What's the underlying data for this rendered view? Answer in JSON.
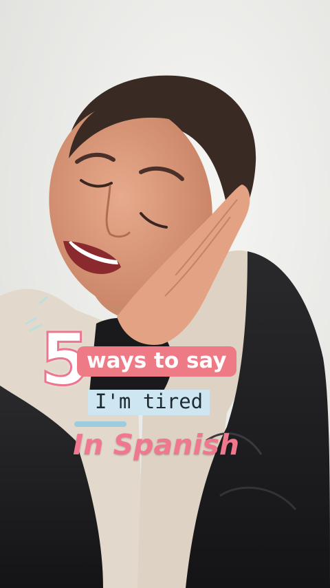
{
  "overlay": {
    "number": "5",
    "line1": "ways to say",
    "line2": "I'm tired",
    "line3": "In Spanish"
  },
  "colors": {
    "pink_accent": "#ee7a86",
    "blue_highlight": "#cde6f2",
    "background_wall": "#eeeeec",
    "jacket": "#1d1d1f",
    "hoodie": "#e3d8cc"
  }
}
